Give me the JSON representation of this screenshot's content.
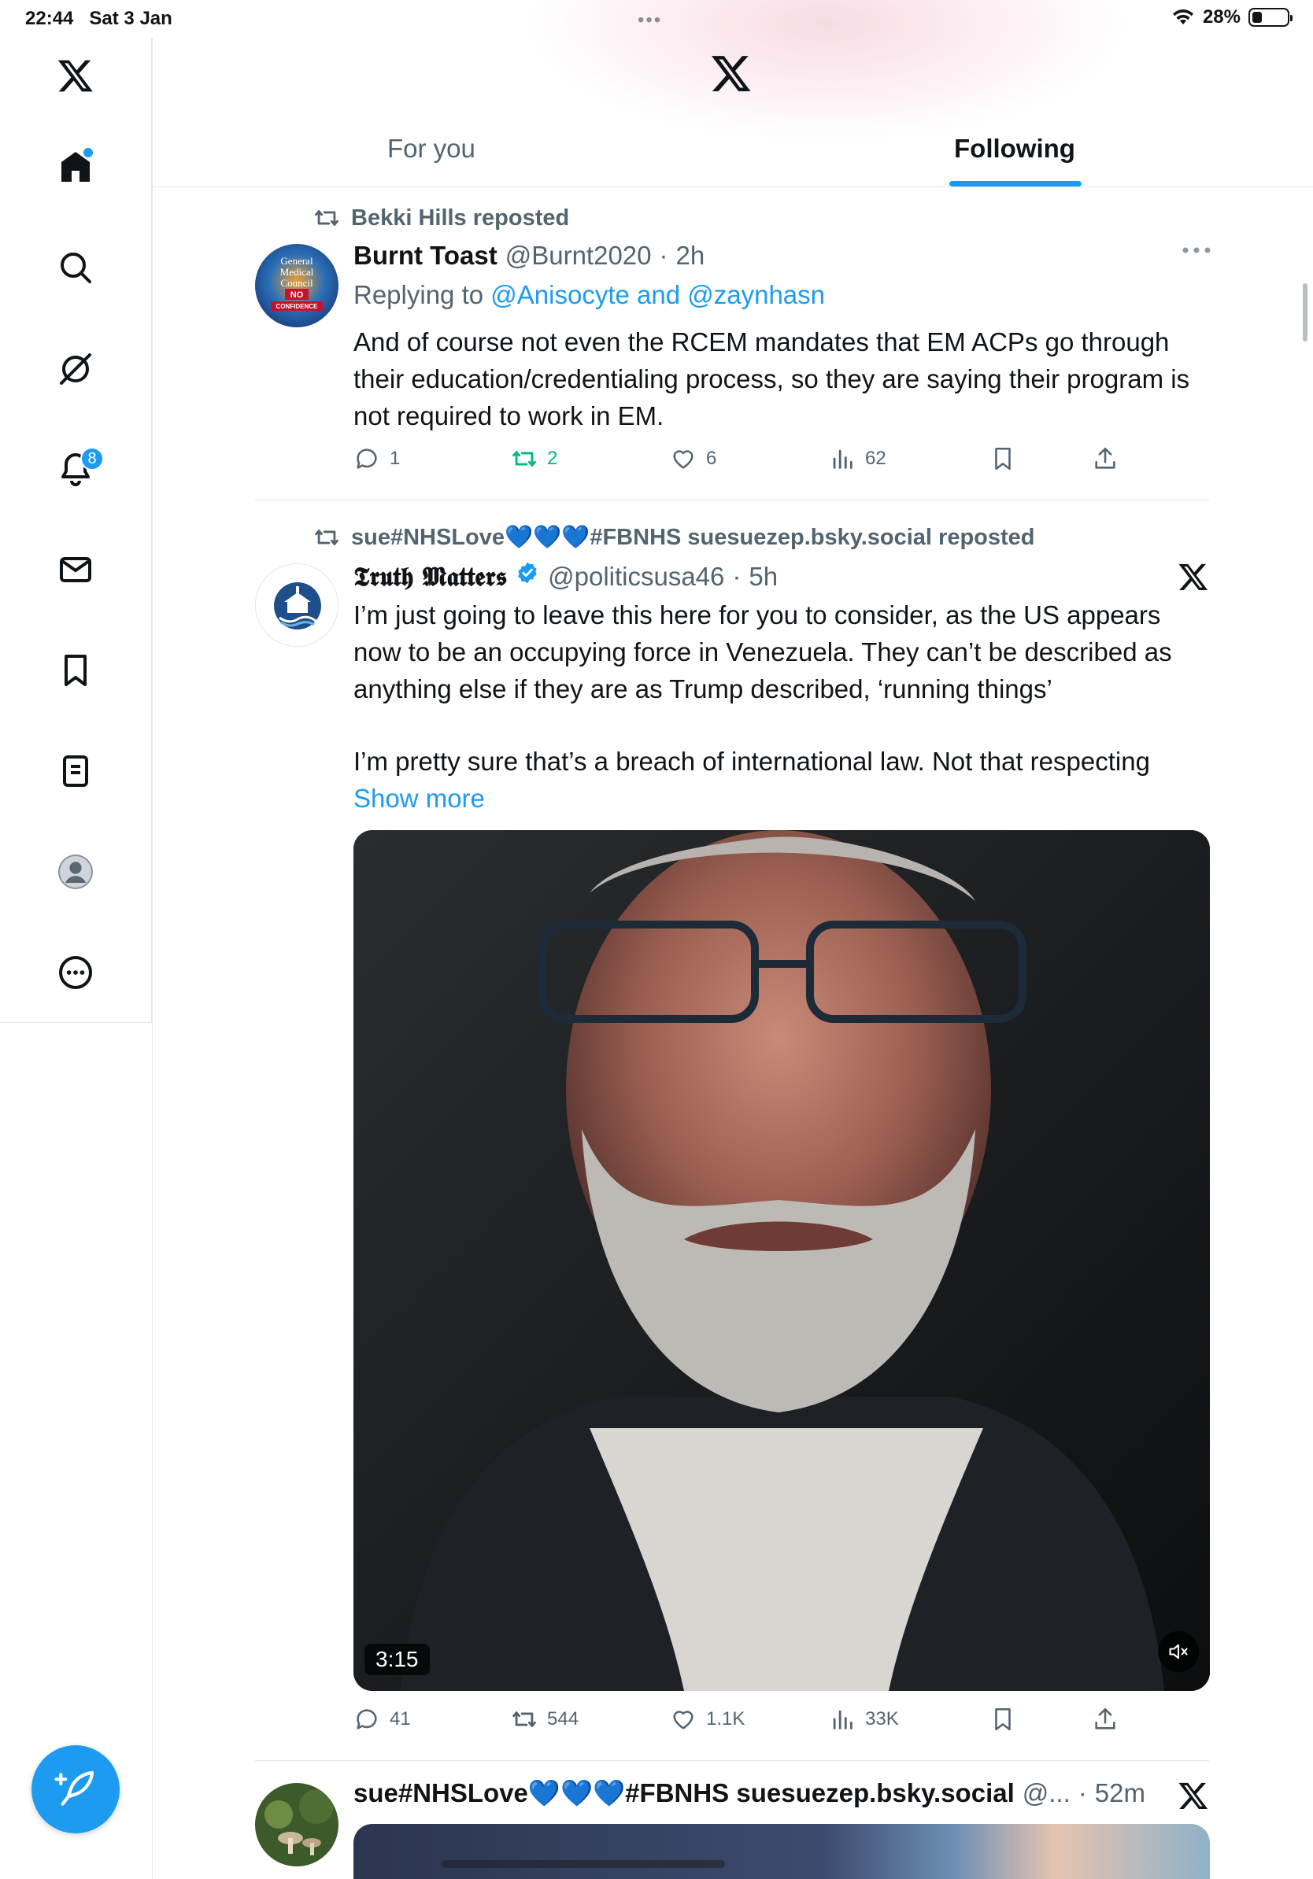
{
  "status_bar": {
    "time": "22:44",
    "date": "Sat 3 Jan",
    "battery_text": "28%",
    "battery_level": 0.28
  },
  "sidebar": {
    "items": [
      {
        "name": "home",
        "icon": "home-icon"
      },
      {
        "name": "explore",
        "icon": "search-icon"
      },
      {
        "name": "grok",
        "icon": "grok-icon"
      },
      {
        "name": "notifications",
        "icon": "bell-icon",
        "badge": "8"
      },
      {
        "name": "messages",
        "icon": "envelope-icon"
      },
      {
        "name": "bookmarks",
        "icon": "bookmark-icon"
      },
      {
        "name": "lists",
        "icon": "list-icon"
      },
      {
        "name": "profile",
        "icon": "avatar-icon"
      },
      {
        "name": "more",
        "icon": "more-circle-icon"
      }
    ]
  },
  "tabs": {
    "for_you": "For you",
    "following": "Following",
    "active": "following"
  },
  "tweets": [
    {
      "reposted_by": "Bekki Hills reposted",
      "name": "Burnt Toast",
      "handle": "@Burnt2020",
      "sep": "·",
      "time": "2h",
      "replying_prefix": "Replying to",
      "replying_to": "@Anisocyte and @zaynhasn",
      "text": "And of course not even the RCEM mandates that EM ACPs go through their education/credentialing  process, so they are saying their program is not required to work in EM.",
      "replies": "1",
      "reposts": "2",
      "likes": "6",
      "views": "62",
      "avatar_text": [
        "General",
        "Medical",
        "Council",
        "NO",
        "CONFIDENCE"
      ]
    },
    {
      "reposted_by": "sue#NHSLove💙💙💙#FBNHS suesuezep.bsky.social reposted",
      "name": "𝕿𝖗𝖚𝖙𝖍 𝕸𝖆𝖙𝖙𝖊𝖗𝖘",
      "handle": "@politicsusa46",
      "sep": "·",
      "time": "5h",
      "text_p1": "I’m just going to leave this here for you to consider, as the US appears now to be an occupying force in Venezuela. They can’t be described as anything else if they are as Trump described, ‘running things’",
      "text_p2": "I’m pretty sure that’s a breach of international law. Not that respecting",
      "show_more": "Show more",
      "video_duration": "3:15",
      "replies": "41",
      "reposts": "544",
      "likes": "1.1K",
      "views": "33K"
    },
    {
      "name": "sue#NHSLove💙💙💙#FBNHS suesuezep.bsky.social",
      "handle": "@...",
      "sep": "·",
      "time": "52m"
    }
  ],
  "colors": {
    "accent": "#1d9bf0",
    "repost_green": "#00ba7c",
    "text_primary": "#0f1419",
    "text_secondary": "#536471"
  }
}
